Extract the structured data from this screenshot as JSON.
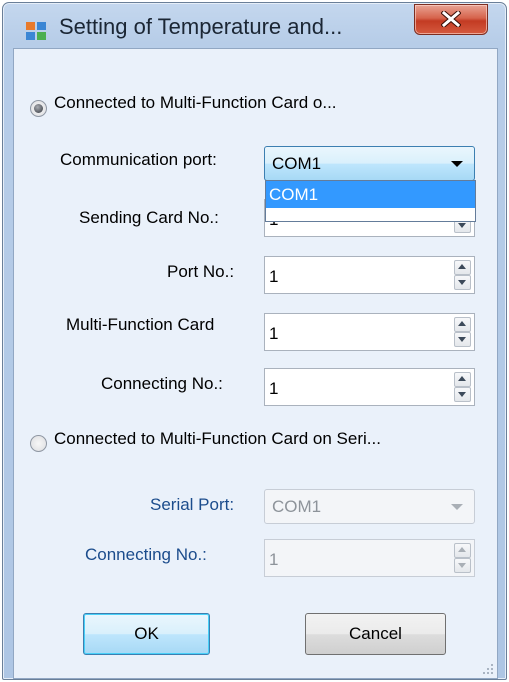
{
  "window": {
    "title": "Setting of Temperature and...",
    "app_icon": "app-icon",
    "close_icon": "close-icon",
    "accent_color": "#3399ff"
  },
  "option_multi_function": {
    "label": "Connected to Multi-Function Card o...",
    "selected": true,
    "communication_port": {
      "label": "Communication port:",
      "value": "COM1",
      "dropdown_open": true,
      "options": [
        "COM1"
      ]
    },
    "sending_card": {
      "label": "Sending Card No.:",
      "value": "1"
    },
    "port_no": {
      "label": "Port No.:",
      "value": "1"
    },
    "multi_function_card": {
      "label": "Multi-Function Card",
      "value": "1"
    },
    "connecting_no": {
      "label": "Connecting No.:",
      "value": "1"
    }
  },
  "option_serial": {
    "label": "Connected to Multi-Function Card on Seri...",
    "selected": false,
    "serial_port": {
      "label": "Serial Port:",
      "value": "COM1"
    },
    "connecting_no": {
      "label": "Connecting No.:",
      "value": "1"
    }
  },
  "buttons": {
    "ok": "OK",
    "cancel": "Cancel"
  }
}
